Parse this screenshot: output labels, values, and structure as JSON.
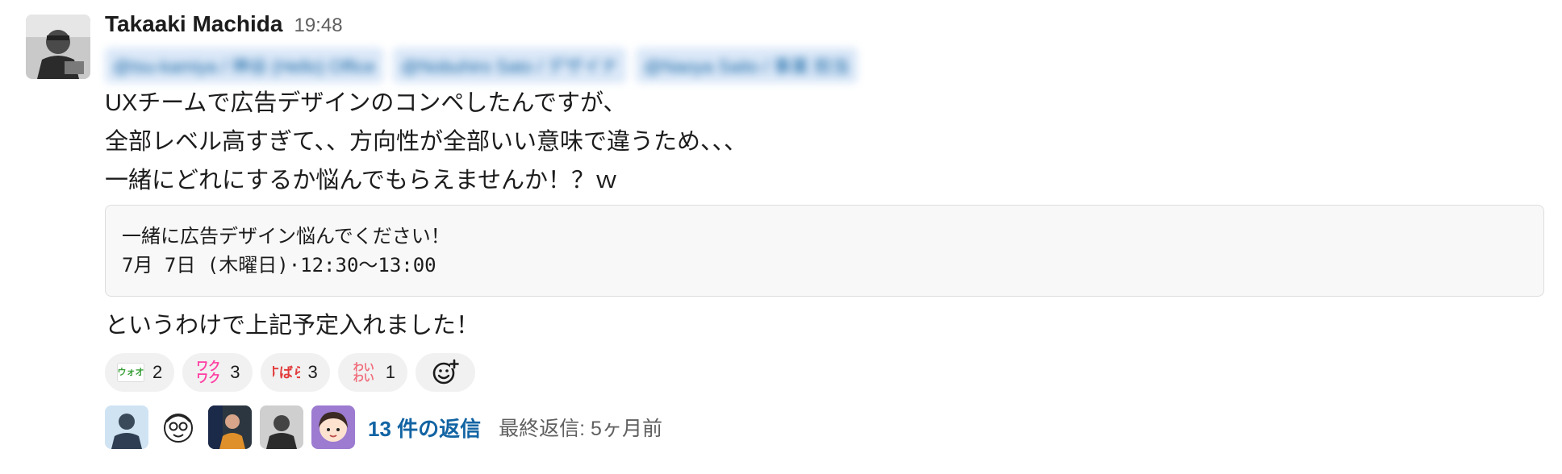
{
  "message": {
    "author": "Takaaki Machida",
    "time": "19:48",
    "mentions": [
      "@tsu-kamiya / 神谷 (Hello) Office",
      "@Nobuhiro Sato / デザイナ",
      "@Naoya Saito / 事業 担当"
    ],
    "lines": [
      "UXチームで広告デザインのコンペしたんですが、",
      "全部レベル高すぎて、、方向性が全部いい意味で違うため、、、",
      "一緒にどれにするか悩んでもらえませんか！？ｗ"
    ],
    "code_lines": [
      "一緒に広告デザイン悩んでください！",
      "7月 7日 (木曜日)·12:30〜13:00"
    ],
    "after_text": "というわけで上記予定入れました！"
  },
  "reactions": [
    {
      "emoji": "wooo-icon",
      "emoji_text": "ウォオ",
      "count": "2"
    },
    {
      "emoji": "wakuwaku-icon",
      "emoji_text_1": "ワク",
      "emoji_text_2": "ワク",
      "count": "3"
    },
    {
      "emoji": "subarashii-icon",
      "emoji_text": "すばら",
      "count": "3"
    },
    {
      "emoji": "waiwai-icon",
      "emoji_text_1": "わい",
      "emoji_text_2": "わい",
      "count": "1"
    }
  ],
  "thread": {
    "replies": "13 件の返信",
    "last_reply": "最終返信: 5ヶ月前"
  },
  "colors": {
    "link": "#1264a3",
    "reaction_bg": "#f1f1f1",
    "code_bg": "#f8f8f8"
  }
}
